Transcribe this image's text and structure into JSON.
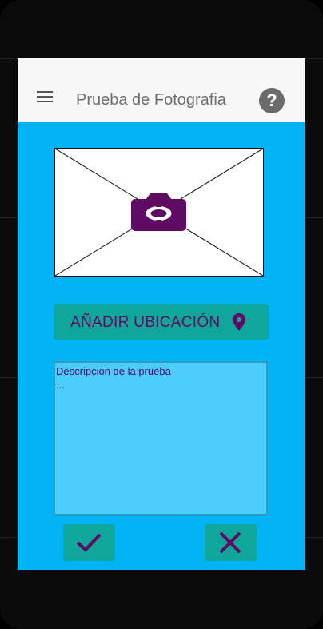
{
  "app_bar": {
    "title": "Prueba de Fotografia",
    "menu_icon": "menu-icon",
    "help_icon": "help-icon",
    "help_glyph": "?"
  },
  "photo": {
    "icon": "camera-icon"
  },
  "location_button": {
    "label": "AÑADIR UBICACIÓN",
    "icon": "location-pin-icon"
  },
  "description": {
    "value": "Descripcion de la prueba\n..."
  },
  "actions": {
    "confirm_icon": "check-icon",
    "cancel_icon": "close-icon"
  },
  "colors": {
    "screen_bg": "#00b4f5",
    "app_bar_bg": "#f7f7f7",
    "button_bg": "#11a69c",
    "accent_purple": "#5f0a63",
    "text_area_bg": "#4bcdfb"
  }
}
